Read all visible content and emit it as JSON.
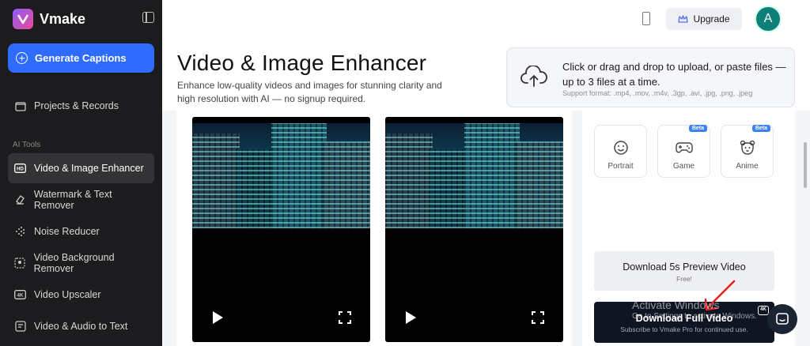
{
  "brand": {
    "name": "Vmake"
  },
  "sidebar": {
    "primary_button": "Generate Captions",
    "projects": "Projects & Records",
    "section_label": "AI Tools",
    "items": [
      {
        "label": "Video & Image Enhancer",
        "icon": "hd-icon",
        "active": true
      },
      {
        "label": "Watermark & Text Remover",
        "icon": "eraser-icon",
        "active": false
      },
      {
        "label": "Noise Reducer",
        "icon": "noise-icon",
        "active": false
      },
      {
        "label": "Video Background Remover",
        "icon": "cutout-icon",
        "active": false
      },
      {
        "label": "Video Upscaler",
        "icon": "4k-icon",
        "active": false
      },
      {
        "label": "Video & Audio to Text",
        "icon": "transcribe-icon",
        "active": false
      }
    ]
  },
  "header": {
    "upgrade": "Upgrade",
    "avatar_initial": "A"
  },
  "page": {
    "title": "Video & Image Enhancer",
    "subtitle": "Enhance low-quality videos and images for stunning clarity and high resolution with AI — no signup required."
  },
  "upload": {
    "main_text": "Click or drag and drop to upload, or paste files — up to 3 files at a time.",
    "formats": "Support format: .mp4, .mov, .m4v, .3gp, .avi, .jpg, .png, .jpeg"
  },
  "modes": [
    {
      "label": "Portrait",
      "beta": ""
    },
    {
      "label": "Game",
      "beta": "Beta"
    },
    {
      "label": "Anime",
      "beta": "Beta"
    }
  ],
  "actions": {
    "preview_label": "Download 5s Preview Video",
    "preview_sub": "Free!",
    "full_label": "Download Full Video",
    "full_sub": "Subscribe to Vmake Pro for continued use.",
    "full_badge": "4K"
  },
  "overlay": {
    "activate_line1": "Activate Windows",
    "activate_line2": "Go to Settings to activate Windows."
  },
  "colors": {
    "accent": "#2f6bff",
    "sidebar_bg": "#1c1c1e",
    "dark_button": "#0f1522",
    "avatar": "#0f7f7a"
  }
}
